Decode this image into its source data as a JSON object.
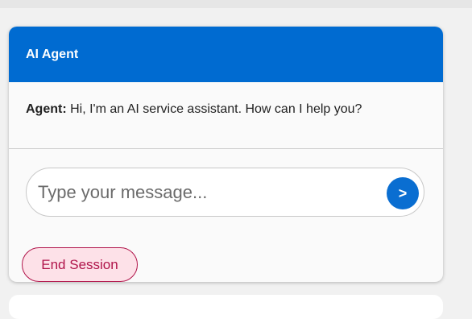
{
  "header": {
    "title": "AI Agent"
  },
  "messages": [
    {
      "sender": "Agent:",
      "text": "Hi, I'm an AI service assistant. How can I help you?"
    }
  ],
  "composer": {
    "placeholder": "Type your message...",
    "send_label": ">"
  },
  "actions": {
    "end_session_label": "End Session"
  },
  "colors": {
    "header_bg": "#006bd1",
    "send_button": "#0a6ed1",
    "end_button_bg": "#fde1e8",
    "end_button_text": "#b0144a"
  }
}
